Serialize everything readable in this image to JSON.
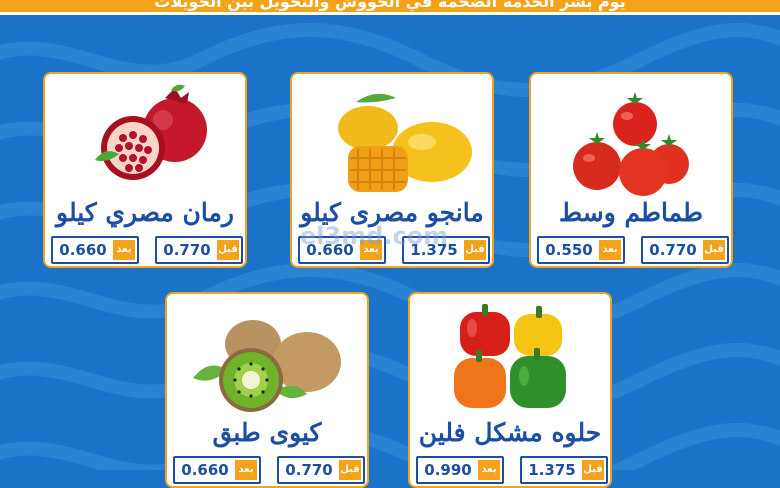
{
  "banner": {
    "text": "يوم بشر الخدمة الضخمة في الحووش والتحويل بين الحويلات"
  },
  "watermark": "el3md.com",
  "labels": {
    "before": "قبل",
    "after": "بعد"
  },
  "products": [
    {
      "name": "رمان مصري كيلو",
      "before": "0.770",
      "after": "0.660",
      "image": "pomegranate-image"
    },
    {
      "name": "مانجو مصرى كيلو",
      "before": "1.375",
      "after": "0.660",
      "image": "mango-image"
    },
    {
      "name": "طماطم وسط",
      "before": "0.770",
      "after": "0.550",
      "image": "tomato-image"
    },
    {
      "name": "كيوى طبق",
      "before": "0.770",
      "after": "0.660",
      "image": "kiwi-image"
    },
    {
      "name": "حلوه مشكل فلين",
      "before": "1.375",
      "after": "0.990",
      "image": "bell-pepper-image"
    }
  ],
  "colors": {
    "background": "#1a73c9",
    "accent": "#f3a21a",
    "text": "#1b4fa3"
  }
}
